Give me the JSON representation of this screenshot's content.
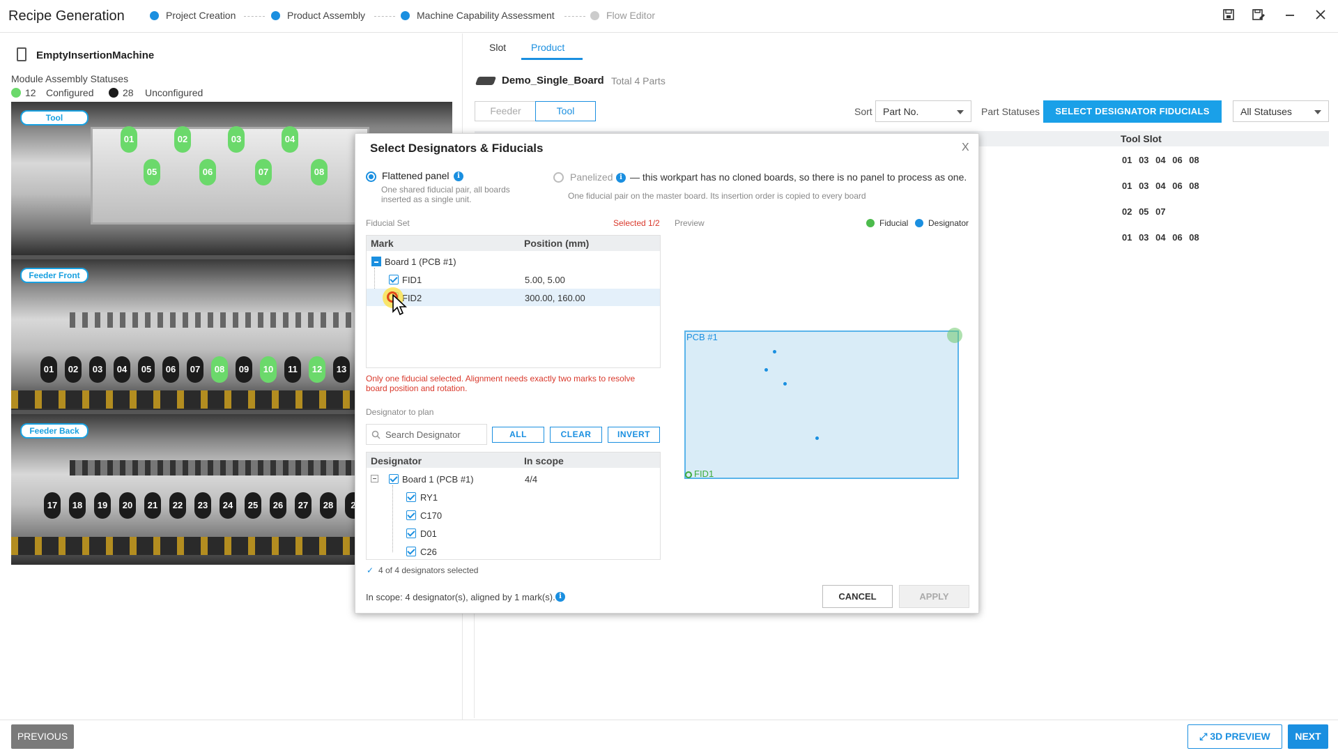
{
  "header": {
    "app_title": "Recipe Generation",
    "steps": [
      {
        "label": "Project Creation",
        "state": "done"
      },
      {
        "label": "Product Assembly",
        "state": "done"
      },
      {
        "label": "Machine Capability Assessment",
        "state": "active"
      },
      {
        "label": "Flow Editor",
        "state": "pending"
      }
    ],
    "window_icons": [
      "save-icon",
      "save-as-icon",
      "minimize-icon",
      "close-icon"
    ]
  },
  "left": {
    "machine_name": "EmptyInsertionMachine",
    "statuses_label": "Module Assembly Statuses",
    "configured_count": "12",
    "configured_label": "Configured",
    "unconfigured_count": "28",
    "unconfigured_label": "Unconfigured",
    "sections": {
      "tool": "Tool",
      "feeder_front": "Feeder Front",
      "feeder_back": "Feeder Back"
    },
    "tool_nozzles_top": [
      "01",
      "02",
      "03",
      "04"
    ],
    "tool_nozzles_bottom": [
      "05",
      "06",
      "07",
      "08"
    ],
    "feeder_front_slots": [
      "01",
      "02",
      "03",
      "04",
      "05",
      "06",
      "07",
      "08",
      "09",
      "10",
      "11",
      "12",
      "13"
    ],
    "feeder_front_configured": [
      "08",
      "10",
      "12"
    ],
    "feeder_back_slots": [
      "17",
      "18",
      "19",
      "20",
      "21",
      "22",
      "23",
      "24",
      "25",
      "26",
      "27",
      "28",
      "2"
    ]
  },
  "right": {
    "tabs": [
      "Slot",
      "Product"
    ],
    "active_tab": "Product",
    "board_name": "Demo_Single_Board",
    "board_total": "Total 4 Parts",
    "segment": {
      "feeder": "Feeder",
      "tool": "Tool",
      "active": "Tool"
    },
    "sort_label": "Sort",
    "sort_value": "Part No.",
    "part_statuses_label": "Part Statuses",
    "select_button": "SELECT DESIGNATOR  FIDUCIALS",
    "status_filter": "All Statuses",
    "tool_slot_header": "Tool Slot",
    "tool_slot_rows": [
      "01 03 04 06 08",
      "01 03 04 06 08",
      "02 05 07",
      "01 03 04 06 08"
    ]
  },
  "dialog": {
    "title": "Select Designators & Fiducials",
    "close": "X",
    "option_flattened": "Flattened panel",
    "option_flattened_desc": "One shared fiducial pair, all boards inserted as a single unit.",
    "option_panelized": "Panelized",
    "option_panelized_note": "— this workpart has no cloned boards, so there is no panel to process as one.",
    "option_panelized_desc": "One fiducial pair on the master board. Its insertion order is copied to every board",
    "fiducial_set_label": "Fiducial Set",
    "fiducial_selected": "Selected 1/2",
    "preview_label": "Preview",
    "legend_fiducial": "Fiducial",
    "legend_designator": "Designator",
    "fid_table": {
      "headers": [
        "Mark",
        "Position (mm)"
      ],
      "group": "Board 1  (PCB #1)",
      "rows": [
        {
          "mark": "FID1",
          "position": "5.00, 5.00",
          "checked": true
        },
        {
          "mark": "FID2",
          "position": "300.00, 160.00",
          "checked": false
        }
      ]
    },
    "warning": "Only one fiducial selected. Alignment needs exactly two marks to resolve board position and rotation.",
    "designator_label": "Designator to plan",
    "search_placeholder": "Search Designator",
    "btn_all": "ALL",
    "btn_clear": "CLEAR",
    "btn_invert": "INVERT",
    "des_table": {
      "headers": [
        "Designator",
        "In scope"
      ],
      "group": "Board 1  (PCB #1)",
      "group_scope": "4/4",
      "rows": [
        "RY1",
        "C170",
        "D01",
        "C26"
      ]
    },
    "des_summary": "4 of 4 designators selected",
    "pcb_label": "PCB #1",
    "pcb_fid_label": "FID1",
    "footer_text": "In scope: 4 designator(s), aligned by 1 mark(s).",
    "btn_cancel": "CANCEL",
    "btn_apply": "APPLY"
  },
  "footer": {
    "previous": "PREVIOUS",
    "preview3d": "3D PREVIEW",
    "next": "NEXT"
  },
  "colors": {
    "accent": "#1a8fe0",
    "configured": "#6bd96b",
    "unconfigured": "#1c1c1c",
    "warning": "#d9382b"
  }
}
